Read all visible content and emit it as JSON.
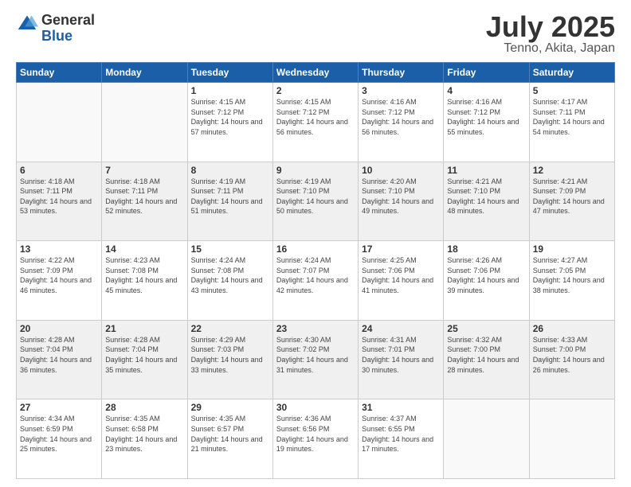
{
  "logo": {
    "general": "General",
    "blue": "Blue"
  },
  "title": "July 2025",
  "subtitle": "Tenno, Akita, Japan",
  "headers": [
    "Sunday",
    "Monday",
    "Tuesday",
    "Wednesday",
    "Thursday",
    "Friday",
    "Saturday"
  ],
  "weeks": [
    [
      {
        "day": "",
        "info": ""
      },
      {
        "day": "",
        "info": ""
      },
      {
        "day": "1",
        "info": "Sunrise: 4:15 AM\nSunset: 7:12 PM\nDaylight: 14 hours and 57 minutes."
      },
      {
        "day": "2",
        "info": "Sunrise: 4:15 AM\nSunset: 7:12 PM\nDaylight: 14 hours and 56 minutes."
      },
      {
        "day": "3",
        "info": "Sunrise: 4:16 AM\nSunset: 7:12 PM\nDaylight: 14 hours and 56 minutes."
      },
      {
        "day": "4",
        "info": "Sunrise: 4:16 AM\nSunset: 7:12 PM\nDaylight: 14 hours and 55 minutes."
      },
      {
        "day": "5",
        "info": "Sunrise: 4:17 AM\nSunset: 7:11 PM\nDaylight: 14 hours and 54 minutes."
      }
    ],
    [
      {
        "day": "6",
        "info": "Sunrise: 4:18 AM\nSunset: 7:11 PM\nDaylight: 14 hours and 53 minutes."
      },
      {
        "day": "7",
        "info": "Sunrise: 4:18 AM\nSunset: 7:11 PM\nDaylight: 14 hours and 52 minutes."
      },
      {
        "day": "8",
        "info": "Sunrise: 4:19 AM\nSunset: 7:11 PM\nDaylight: 14 hours and 51 minutes."
      },
      {
        "day": "9",
        "info": "Sunrise: 4:19 AM\nSunset: 7:10 PM\nDaylight: 14 hours and 50 minutes."
      },
      {
        "day": "10",
        "info": "Sunrise: 4:20 AM\nSunset: 7:10 PM\nDaylight: 14 hours and 49 minutes."
      },
      {
        "day": "11",
        "info": "Sunrise: 4:21 AM\nSunset: 7:10 PM\nDaylight: 14 hours and 48 minutes."
      },
      {
        "day": "12",
        "info": "Sunrise: 4:21 AM\nSunset: 7:09 PM\nDaylight: 14 hours and 47 minutes."
      }
    ],
    [
      {
        "day": "13",
        "info": "Sunrise: 4:22 AM\nSunset: 7:09 PM\nDaylight: 14 hours and 46 minutes."
      },
      {
        "day": "14",
        "info": "Sunrise: 4:23 AM\nSunset: 7:08 PM\nDaylight: 14 hours and 45 minutes."
      },
      {
        "day": "15",
        "info": "Sunrise: 4:24 AM\nSunset: 7:08 PM\nDaylight: 14 hours and 43 minutes."
      },
      {
        "day": "16",
        "info": "Sunrise: 4:24 AM\nSunset: 7:07 PM\nDaylight: 14 hours and 42 minutes."
      },
      {
        "day": "17",
        "info": "Sunrise: 4:25 AM\nSunset: 7:06 PM\nDaylight: 14 hours and 41 minutes."
      },
      {
        "day": "18",
        "info": "Sunrise: 4:26 AM\nSunset: 7:06 PM\nDaylight: 14 hours and 39 minutes."
      },
      {
        "day": "19",
        "info": "Sunrise: 4:27 AM\nSunset: 7:05 PM\nDaylight: 14 hours and 38 minutes."
      }
    ],
    [
      {
        "day": "20",
        "info": "Sunrise: 4:28 AM\nSunset: 7:04 PM\nDaylight: 14 hours and 36 minutes."
      },
      {
        "day": "21",
        "info": "Sunrise: 4:28 AM\nSunset: 7:04 PM\nDaylight: 14 hours and 35 minutes."
      },
      {
        "day": "22",
        "info": "Sunrise: 4:29 AM\nSunset: 7:03 PM\nDaylight: 14 hours and 33 minutes."
      },
      {
        "day": "23",
        "info": "Sunrise: 4:30 AM\nSunset: 7:02 PM\nDaylight: 14 hours and 31 minutes."
      },
      {
        "day": "24",
        "info": "Sunrise: 4:31 AM\nSunset: 7:01 PM\nDaylight: 14 hours and 30 minutes."
      },
      {
        "day": "25",
        "info": "Sunrise: 4:32 AM\nSunset: 7:00 PM\nDaylight: 14 hours and 28 minutes."
      },
      {
        "day": "26",
        "info": "Sunrise: 4:33 AM\nSunset: 7:00 PM\nDaylight: 14 hours and 26 minutes."
      }
    ],
    [
      {
        "day": "27",
        "info": "Sunrise: 4:34 AM\nSunset: 6:59 PM\nDaylight: 14 hours and 25 minutes."
      },
      {
        "day": "28",
        "info": "Sunrise: 4:35 AM\nSunset: 6:58 PM\nDaylight: 14 hours and 23 minutes."
      },
      {
        "day": "29",
        "info": "Sunrise: 4:35 AM\nSunset: 6:57 PM\nDaylight: 14 hours and 21 minutes."
      },
      {
        "day": "30",
        "info": "Sunrise: 4:36 AM\nSunset: 6:56 PM\nDaylight: 14 hours and 19 minutes."
      },
      {
        "day": "31",
        "info": "Sunrise: 4:37 AM\nSunset: 6:55 PM\nDaylight: 14 hours and 17 minutes."
      },
      {
        "day": "",
        "info": ""
      },
      {
        "day": "",
        "info": ""
      }
    ]
  ]
}
